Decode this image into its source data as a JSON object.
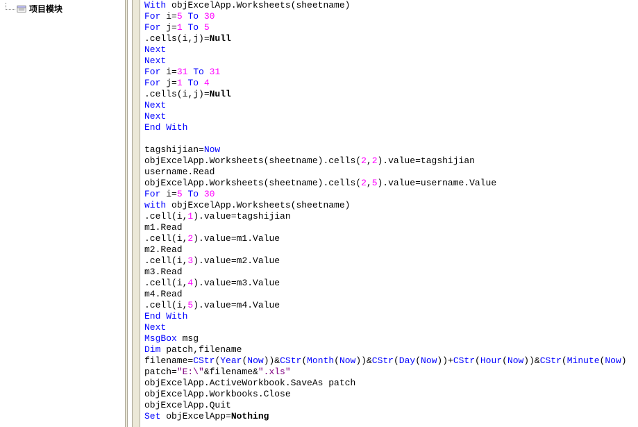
{
  "tree": {
    "item_label": "项目模块"
  },
  "code": {
    "lines": [
      [
        {
          "t": "With",
          "c": "kw"
        },
        {
          "t": " objExcelApp.Worksheets(sheetname)"
        }
      ],
      [
        {
          "t": "For",
          "c": "kw"
        },
        {
          "t": " i="
        },
        {
          "t": "5",
          "c": "num"
        },
        {
          "t": " "
        },
        {
          "t": "To",
          "c": "kw"
        },
        {
          "t": " "
        },
        {
          "t": "30",
          "c": "num"
        }
      ],
      [
        {
          "t": "For",
          "c": "kw"
        },
        {
          "t": " j="
        },
        {
          "t": "1",
          "c": "num"
        },
        {
          "t": " "
        },
        {
          "t": "To",
          "c": "kw"
        },
        {
          "t": " "
        },
        {
          "t": "5",
          "c": "num"
        }
      ],
      [
        {
          "t": ".cells(i,j)="
        },
        {
          "t": "Null",
          "c": "bold"
        }
      ],
      [
        {
          "t": "Next",
          "c": "kw"
        }
      ],
      [
        {
          "t": "Next",
          "c": "kw"
        }
      ],
      [
        {
          "t": "For",
          "c": "kw"
        },
        {
          "t": " i="
        },
        {
          "t": "31",
          "c": "num"
        },
        {
          "t": " "
        },
        {
          "t": "To",
          "c": "kw"
        },
        {
          "t": " "
        },
        {
          "t": "31",
          "c": "num"
        }
      ],
      [
        {
          "t": "For",
          "c": "kw"
        },
        {
          "t": " j="
        },
        {
          "t": "1",
          "c": "num"
        },
        {
          "t": " "
        },
        {
          "t": "To",
          "c": "kw"
        },
        {
          "t": " "
        },
        {
          "t": "4",
          "c": "num"
        }
      ],
      [
        {
          "t": ".cells(i,j)="
        },
        {
          "t": "Null",
          "c": "bold"
        }
      ],
      [
        {
          "t": "Next",
          "c": "kw"
        }
      ],
      [
        {
          "t": "Next",
          "c": "kw"
        }
      ],
      [
        {
          "t": "End With",
          "c": "kw"
        }
      ],
      [],
      [
        {
          "t": "tagshijian="
        },
        {
          "t": "Now",
          "c": "kw"
        }
      ],
      [
        {
          "t": "objExcelApp.Worksheets(sheetname).cells("
        },
        {
          "t": "2",
          "c": "num"
        },
        {
          "t": ","
        },
        {
          "t": "2",
          "c": "num"
        },
        {
          "t": ").value=tagshijian"
        }
      ],
      [
        {
          "t": "username.Read"
        }
      ],
      [
        {
          "t": "objExcelApp.Worksheets(sheetname).cells("
        },
        {
          "t": "2",
          "c": "num"
        },
        {
          "t": ","
        },
        {
          "t": "5",
          "c": "num"
        },
        {
          "t": ").value=username.Value"
        }
      ],
      [
        {
          "t": "For",
          "c": "kw"
        },
        {
          "t": " i="
        },
        {
          "t": "5",
          "c": "num"
        },
        {
          "t": " "
        },
        {
          "t": "To",
          "c": "kw"
        },
        {
          "t": " "
        },
        {
          "t": "30",
          "c": "num"
        }
      ],
      [
        {
          "t": "with",
          "c": "kw"
        },
        {
          "t": " objExcelApp.Worksheets(sheetname)"
        }
      ],
      [
        {
          "t": ".cell(i,"
        },
        {
          "t": "1",
          "c": "num"
        },
        {
          "t": ").value=tagshijian"
        }
      ],
      [
        {
          "t": "m1.Read"
        }
      ],
      [
        {
          "t": ".cell(i,"
        },
        {
          "t": "2",
          "c": "num"
        },
        {
          "t": ").value=m1.Value"
        }
      ],
      [
        {
          "t": "m2.Read"
        }
      ],
      [
        {
          "t": ".cell(i,"
        },
        {
          "t": "3",
          "c": "num"
        },
        {
          "t": ").value=m2.Value"
        }
      ],
      [
        {
          "t": "m3.Read"
        }
      ],
      [
        {
          "t": ".cell(i,"
        },
        {
          "t": "4",
          "c": "num"
        },
        {
          "t": ").value=m3.Value"
        }
      ],
      [
        {
          "t": "m4.Read"
        }
      ],
      [
        {
          "t": ".cell(i,"
        },
        {
          "t": "5",
          "c": "num"
        },
        {
          "t": ").value=m4.Value"
        }
      ],
      [
        {
          "t": "End With",
          "c": "kw"
        }
      ],
      [
        {
          "t": "Next",
          "c": "kw"
        }
      ],
      [
        {
          "t": "MsgBox",
          "c": "kw"
        },
        {
          "t": " msg"
        }
      ],
      [
        {
          "t": "Dim",
          "c": "kw"
        },
        {
          "t": " patch,filename"
        }
      ],
      [
        {
          "t": "filename="
        },
        {
          "t": "CStr",
          "c": "kw"
        },
        {
          "t": "("
        },
        {
          "t": "Year",
          "c": "kw"
        },
        {
          "t": "("
        },
        {
          "t": "Now",
          "c": "kw"
        },
        {
          "t": "))&"
        },
        {
          "t": "CStr",
          "c": "kw"
        },
        {
          "t": "("
        },
        {
          "t": "Month",
          "c": "kw"
        },
        {
          "t": "("
        },
        {
          "t": "Now",
          "c": "kw"
        },
        {
          "t": "))&"
        },
        {
          "t": "CStr",
          "c": "kw"
        },
        {
          "t": "("
        },
        {
          "t": "Day",
          "c": "kw"
        },
        {
          "t": "("
        },
        {
          "t": "Now",
          "c": "kw"
        },
        {
          "t": "))+"
        },
        {
          "t": "CStr",
          "c": "kw"
        },
        {
          "t": "("
        },
        {
          "t": "Hour",
          "c": "kw"
        },
        {
          "t": "("
        },
        {
          "t": "Now",
          "c": "kw"
        },
        {
          "t": "))&"
        },
        {
          "t": "CStr",
          "c": "kw"
        },
        {
          "t": "("
        },
        {
          "t": "Minute",
          "c": "kw"
        },
        {
          "t": "("
        },
        {
          "t": "Now",
          "c": "kw"
        },
        {
          "t": ")"
        }
      ],
      [
        {
          "t": "patch="
        },
        {
          "t": "\"E:\\\"",
          "c": "str"
        },
        {
          "t": "&filename&"
        },
        {
          "t": "\".xls\"",
          "c": "str"
        }
      ],
      [
        {
          "t": "objExcelApp.ActiveWorkbook.SaveAs patch"
        }
      ],
      [
        {
          "t": "objExcelApp.Workbooks.Close"
        }
      ],
      [
        {
          "t": "objExcelApp.Quit"
        }
      ],
      [
        {
          "t": "Set",
          "c": "kw"
        },
        {
          "t": " objExcelApp="
        },
        {
          "t": "Nothing",
          "c": "bold"
        }
      ]
    ]
  }
}
